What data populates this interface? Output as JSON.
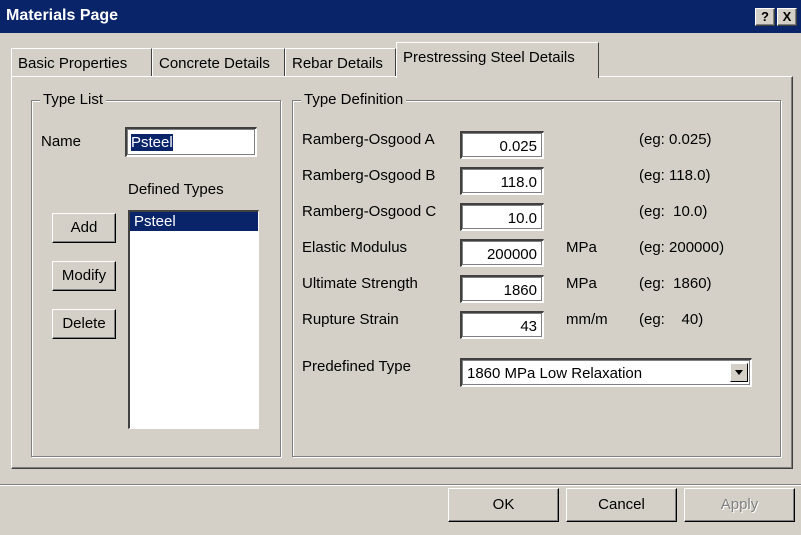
{
  "window": {
    "title": "Materials Page",
    "help_label": "?",
    "close_label": "X"
  },
  "tabs": [
    {
      "label": "Basic Properties"
    },
    {
      "label": "Concrete Details"
    },
    {
      "label": "Rebar Details"
    },
    {
      "label": "Prestressing Steel Details"
    }
  ],
  "type_list": {
    "legend": "Type List",
    "name_label": "Name",
    "name_value": "Psteel",
    "defined_types_label": "Defined Types",
    "defined_types": [
      "Psteel"
    ],
    "add_label": "Add",
    "modify_label": "Modify",
    "delete_label": "Delete"
  },
  "type_definition": {
    "legend": "Type Definition",
    "rows": [
      {
        "label": "Ramberg-Osgood A",
        "value": "0.025",
        "unit": "",
        "example": "(eg: 0.025)"
      },
      {
        "label": "Ramberg-Osgood B",
        "value": "118.0",
        "unit": "",
        "example": "(eg: 118.0)"
      },
      {
        "label": "Ramberg-Osgood C",
        "value": "10.0",
        "unit": "",
        "example": "(eg:  10.0)"
      },
      {
        "label": "Elastic Modulus",
        "value": "200000",
        "unit": "MPa",
        "example": "(eg: 200000)"
      },
      {
        "label": "Ultimate Strength",
        "value": "1860",
        "unit": "MPa",
        "example": "(eg:  1860)"
      },
      {
        "label": "Rupture Strain",
        "value": "43",
        "unit": "mm/m",
        "example": "(eg:    40)"
      }
    ],
    "predefined_label": "Predefined Type",
    "predefined_value": "1860 MPa Low Relaxation"
  },
  "footer": {
    "ok_label": "OK",
    "cancel_label": "Cancel",
    "apply_label": "Apply"
  }
}
